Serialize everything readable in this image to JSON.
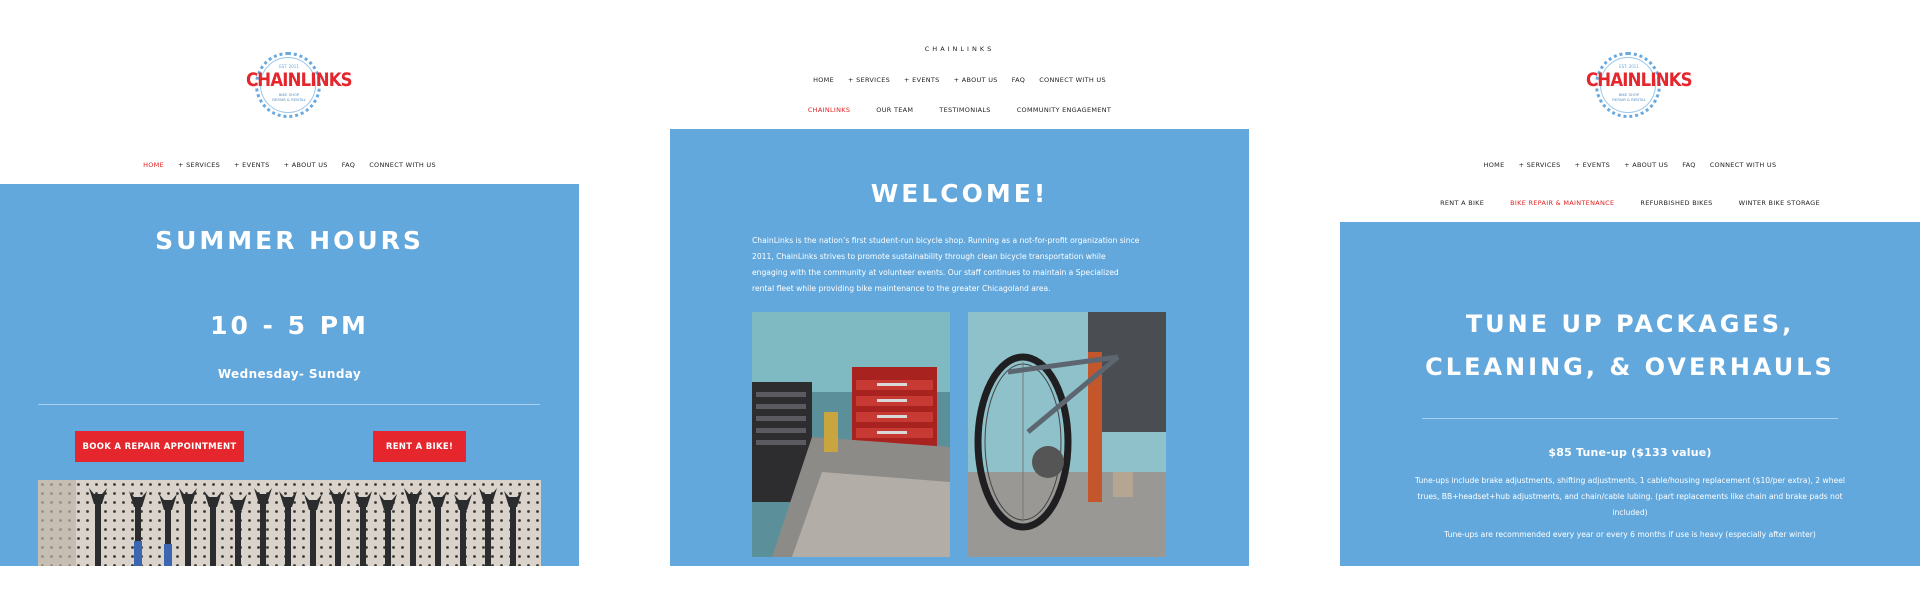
{
  "panel1": {
    "logo": {
      "est": "EST. 2011",
      "word": "CHAINLINKS",
      "sub": [
        "BIKE SHOP",
        "REPAIR & RENTAL"
      ]
    },
    "nav": [
      "HOME",
      "+ SERVICES",
      "+ EVENTS",
      "+ ABOUT US",
      "FAQ",
      "CONNECT WITH US"
    ],
    "nav_active": "HOME",
    "title": "SUMMER HOURS",
    "hours": "10 - 5 PM",
    "days": "Wednesday- Sunday",
    "btn_repair": "BOOK A REPAIR APPOINTMENT",
    "btn_rent": "RENT A BIKE!"
  },
  "panel2": {
    "site_name": "CHAINLINKS",
    "nav": [
      "HOME",
      "+ SERVICES",
      "+ EVENTS",
      "+ ABOUT US",
      "FAQ",
      "CONNECT WITH US"
    ],
    "subnav": [
      "CHAINLINKS",
      "OUR TEAM",
      "TESTIMONIALS",
      "COMMUNITY ENGAGEMENT"
    ],
    "subnav_active": "CHAINLINKS",
    "title": "WELCOME!",
    "paragraph": [
      "ChainLinks is the nation’s first student-run bicycle shop. Running as a not-for-profit organization since",
      "2011, ChainLinks strives to promote sustainability through clean bicycle transportation while",
      "engaging with the community at volunteer events. Our staff continues to maintain a Specialized",
      "rental fleet while providing bike maintenance to the greater Chicagoland area."
    ]
  },
  "panel3": {
    "logo": {
      "est": "EST. 2011",
      "word": "CHAINLINKS",
      "sub": [
        "BIKE SHOP",
        "REPAIR & RENTAL"
      ]
    },
    "nav": [
      "HOME",
      "+ SERVICES",
      "+ EVENTS",
      "+ ABOUT US",
      "FAQ",
      "CONNECT WITH US"
    ],
    "subnav": [
      "RENT A BIKE",
      "BIKE REPAIR & MAINTENANCE",
      "REFURBISHED BIKES",
      "WINTER BIKE STORAGE"
    ],
    "subnav_active": "BIKE REPAIR & MAINTENANCE",
    "title_line1": "TUNE UP PACKAGES,",
    "title_line2": "CLEANING, & OVERHAULS",
    "price": "$85 Tune-up ($133 value)",
    "desc": [
      "Tune-ups include brake adjustments, shifting adjustments, 1 cable/housing replacement ($10/per extra), 2 wheel",
      "trues, BB+headset+hub adjustments, and chain/cable lubing. (part replacements like chain and brake pads not",
      "included)"
    ],
    "note": "Tune-ups are recommended every year or every 6 months if use is heavy (especially after winter)"
  },
  "colors": {
    "blue": "#62a8dd",
    "red": "#e5262d",
    "white": "#ffffff"
  },
  "icons": [
    "chainlinks-logo",
    "wrench-wall-photo",
    "toolbox-photo",
    "bike-stand-photo"
  ]
}
